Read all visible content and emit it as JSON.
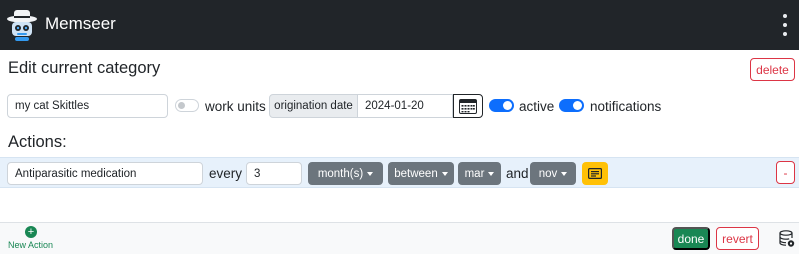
{
  "app": {
    "title": "Memseer"
  },
  "page": {
    "heading": "Edit current category",
    "delete_label": "delete"
  },
  "category": {
    "name_value": "my cat Skittles",
    "work_units_label": "work units",
    "work_units_enabled": false,
    "origination_label": "origination date",
    "origination_value": "2024-01-20",
    "active_label": "active",
    "active_enabled": true,
    "notifications_label": "notifications",
    "notifications_enabled": true
  },
  "actions": {
    "heading": "Actions:",
    "items": [
      {
        "description": "Antiparasitic medication",
        "every_label": "every",
        "interval": "3",
        "units": "month(s)",
        "range_mode": "between",
        "from_month": "mar",
        "and_label": "and",
        "to_month": "nov",
        "remove_label": "-"
      }
    ]
  },
  "footer": {
    "new_action_label": "New Action",
    "done_label": "done",
    "revert_label": "revert"
  },
  "colors": {
    "topbar": "#212529",
    "primary": "#0d6efd",
    "secondary": "#6c757d",
    "success": "#198754",
    "danger": "#dc3545",
    "warning": "#ffc107",
    "action_row": "#e7f1fb"
  },
  "icons": {
    "logo": "robot-hat-logo-icon",
    "menu": "kebab-menu-icon",
    "calendar": "calendar-icon",
    "note": "note-icon",
    "add": "plus-circle-icon",
    "database": "database-gear-icon"
  }
}
